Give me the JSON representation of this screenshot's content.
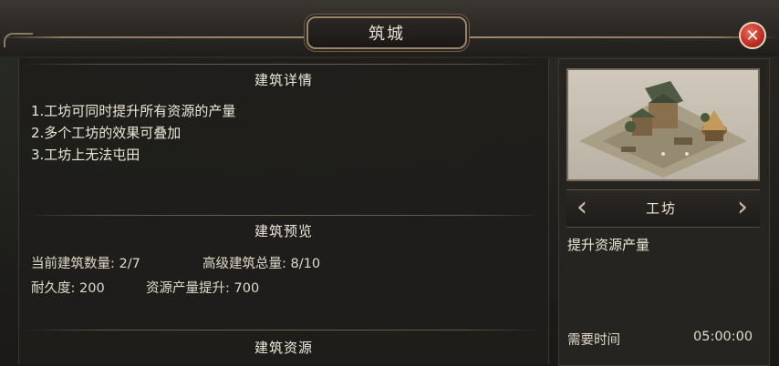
{
  "window": {
    "title": "筑城"
  },
  "close": {
    "symbol": "✕"
  },
  "details": {
    "heading": "建筑详情",
    "lines": [
      "1.工坊可同时提升所有资源的产量",
      "2.多个工坊的效果可叠加",
      "3.工坊上无法屯田"
    ]
  },
  "preview": {
    "heading": "建筑预览",
    "current_count_label": "当前建筑数量:",
    "current_count_value": "2/7",
    "advanced_total_label": "高级建筑总量:",
    "advanced_total_value": "8/10",
    "durability_label": "耐久度:",
    "durability_value": "200",
    "resource_boost_label": "资源产量提升:",
    "resource_boost_value": "700"
  },
  "resources": {
    "heading": "建筑资源"
  },
  "building": {
    "name": "工坊",
    "prev_arrow": "‹",
    "next_arrow": "›",
    "description": "提升资源产量",
    "time_label": "需要时间",
    "time_value": "05:00:00"
  },
  "colors": {
    "accent_gold": "#9a8468",
    "close_red": "#b8281d",
    "panel_dark": "#1e1d1b"
  }
}
